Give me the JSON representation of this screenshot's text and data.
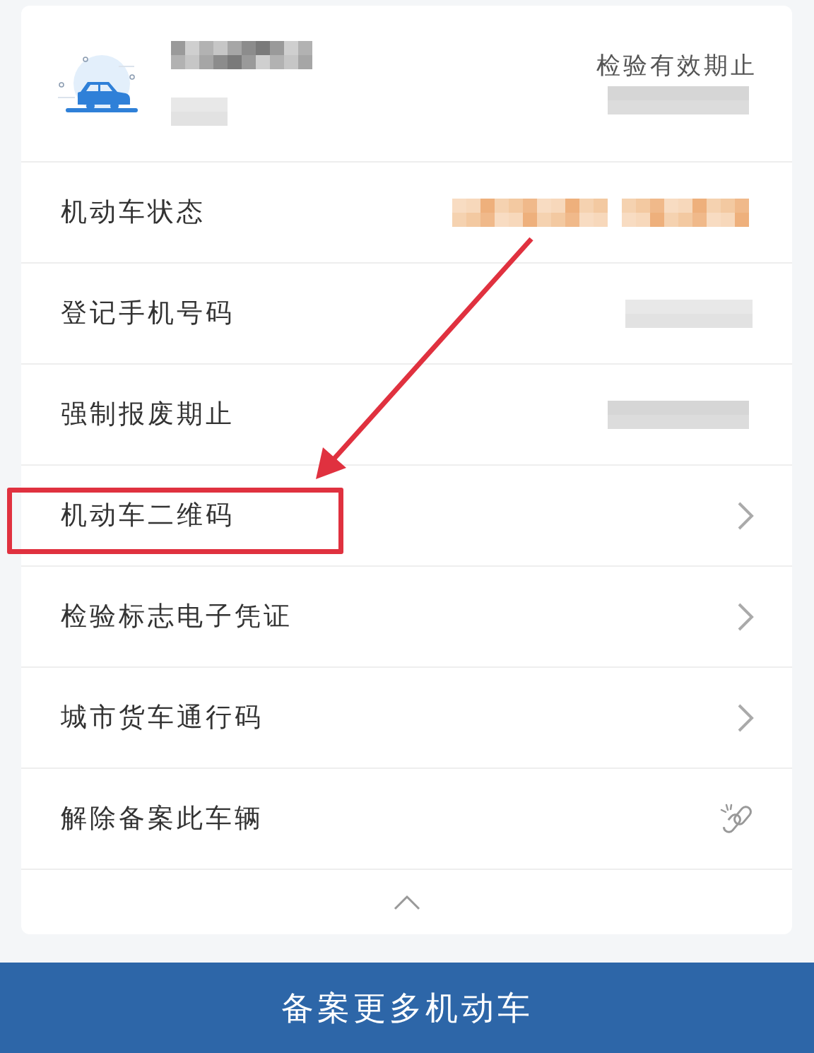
{
  "vehicle": {
    "name": {
      "redacted": true
    },
    "plate": {
      "redacted": true
    }
  },
  "expiry": {
    "label": "检验有效期止",
    "value": {
      "redacted": true
    }
  },
  "rows": [
    {
      "label": "机动车状态",
      "kind": "tags",
      "highlighted": false
    },
    {
      "label": "登记手机号码",
      "kind": "text",
      "highlighted": false
    },
    {
      "label": "强制报废期止",
      "kind": "text",
      "highlighted": false
    },
    {
      "label": "机动车二维码",
      "kind": "link",
      "highlighted": true
    },
    {
      "label": "检验标志电子凭证",
      "kind": "link",
      "highlighted": false
    },
    {
      "label": "城市货车通行码",
      "kind": "link",
      "highlighted": false
    },
    {
      "label": "解除备案此车辆",
      "kind": "unbind",
      "highlighted": false
    }
  ],
  "collapse": {
    "expanded": true
  },
  "annotation_arrow": true,
  "primary_button": {
    "label": "备案更多机动车"
  }
}
